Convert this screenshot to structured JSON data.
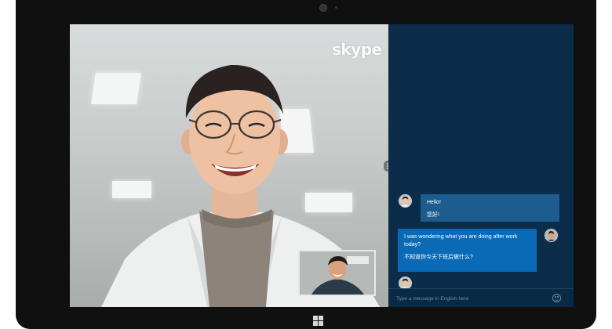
{
  "app": {
    "logo_text": "skype"
  },
  "chat": {
    "messages": [
      {
        "sender": "remote",
        "original": "Hello!",
        "translation": "您好!"
      },
      {
        "sender": "self",
        "original_line1": "I was wondering what you are doing after work",
        "original_line2": "today?",
        "translation": "不知道你今天下班后做什么?"
      }
    ],
    "input_placeholder": "Type a message in English here"
  },
  "icons": {
    "call_tab_handle": "more-dots-icon",
    "emoji": "emoji-icon",
    "windows": "windows-logo-icon"
  },
  "colors": {
    "chat_background": "#0b2d4a",
    "bubble_received": "#1c5c8e",
    "bubble_sent": "#0a6ab6"
  }
}
